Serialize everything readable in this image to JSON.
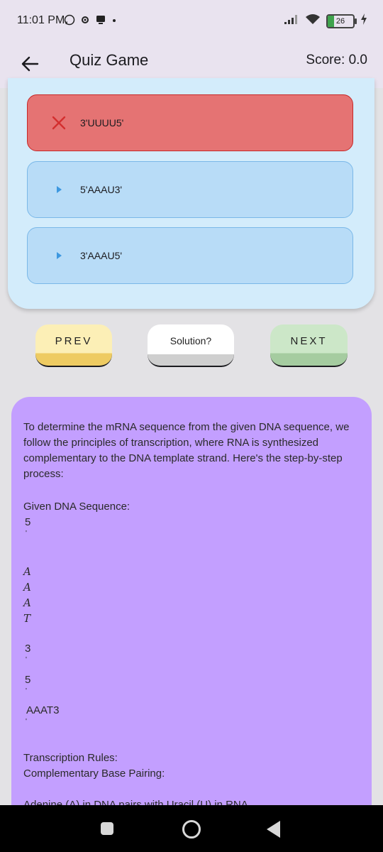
{
  "status_bar": {
    "time": "11:01 PM",
    "battery_level": "26",
    "icons": [
      "whatsapp-icon",
      "settings-icon",
      "notification-icon",
      "dot-icon",
      "signal-icon",
      "wifi-icon",
      "battery-icon",
      "charging-icon"
    ]
  },
  "app_bar": {
    "title": "Quiz Game",
    "score": "Score: 0.0"
  },
  "quiz": {
    "options": [
      {
        "label": "3'UUUU5'",
        "state": "wrong"
      },
      {
        "label": "5'AAAU3'",
        "state": "neutral"
      },
      {
        "label": "3'AAAU5'",
        "state": "neutral"
      }
    ]
  },
  "buttons": {
    "prev": "PREV",
    "solution": "Solution?",
    "next": "NEXT"
  },
  "solution": {
    "intro": "To determine the mRNA sequence from the given DNA sequence, we follow the principles of transcription, where RNA is synthesized complementary to the DNA template strand. Here's the step-by-step process:",
    "given_heading": "Given DNA Sequence:",
    "five_1": "5",
    "prime_1": "'",
    "base_a1": "A",
    "base_a2": "A",
    "base_a3": "A",
    "base_t": "T",
    "three": "3",
    "prime_2": "'",
    "five_2": "5",
    "prime_3": "'",
    "aaat3": "AAAT3",
    "prime_4": "'",
    "rules_heading": "Transcription Rules:",
    "pairing_heading": "Complementary Base Pairing:",
    "pairing_line": "Adenine (A) in DNA pairs with Uracil (U) in RNA."
  },
  "colors": {
    "wrong": "#e57373",
    "option": "#b8dcf7",
    "card": "#d3ecfb",
    "solution_panel": "#c39fff",
    "prev": "#fcefb6",
    "next": "#cce7c8"
  }
}
